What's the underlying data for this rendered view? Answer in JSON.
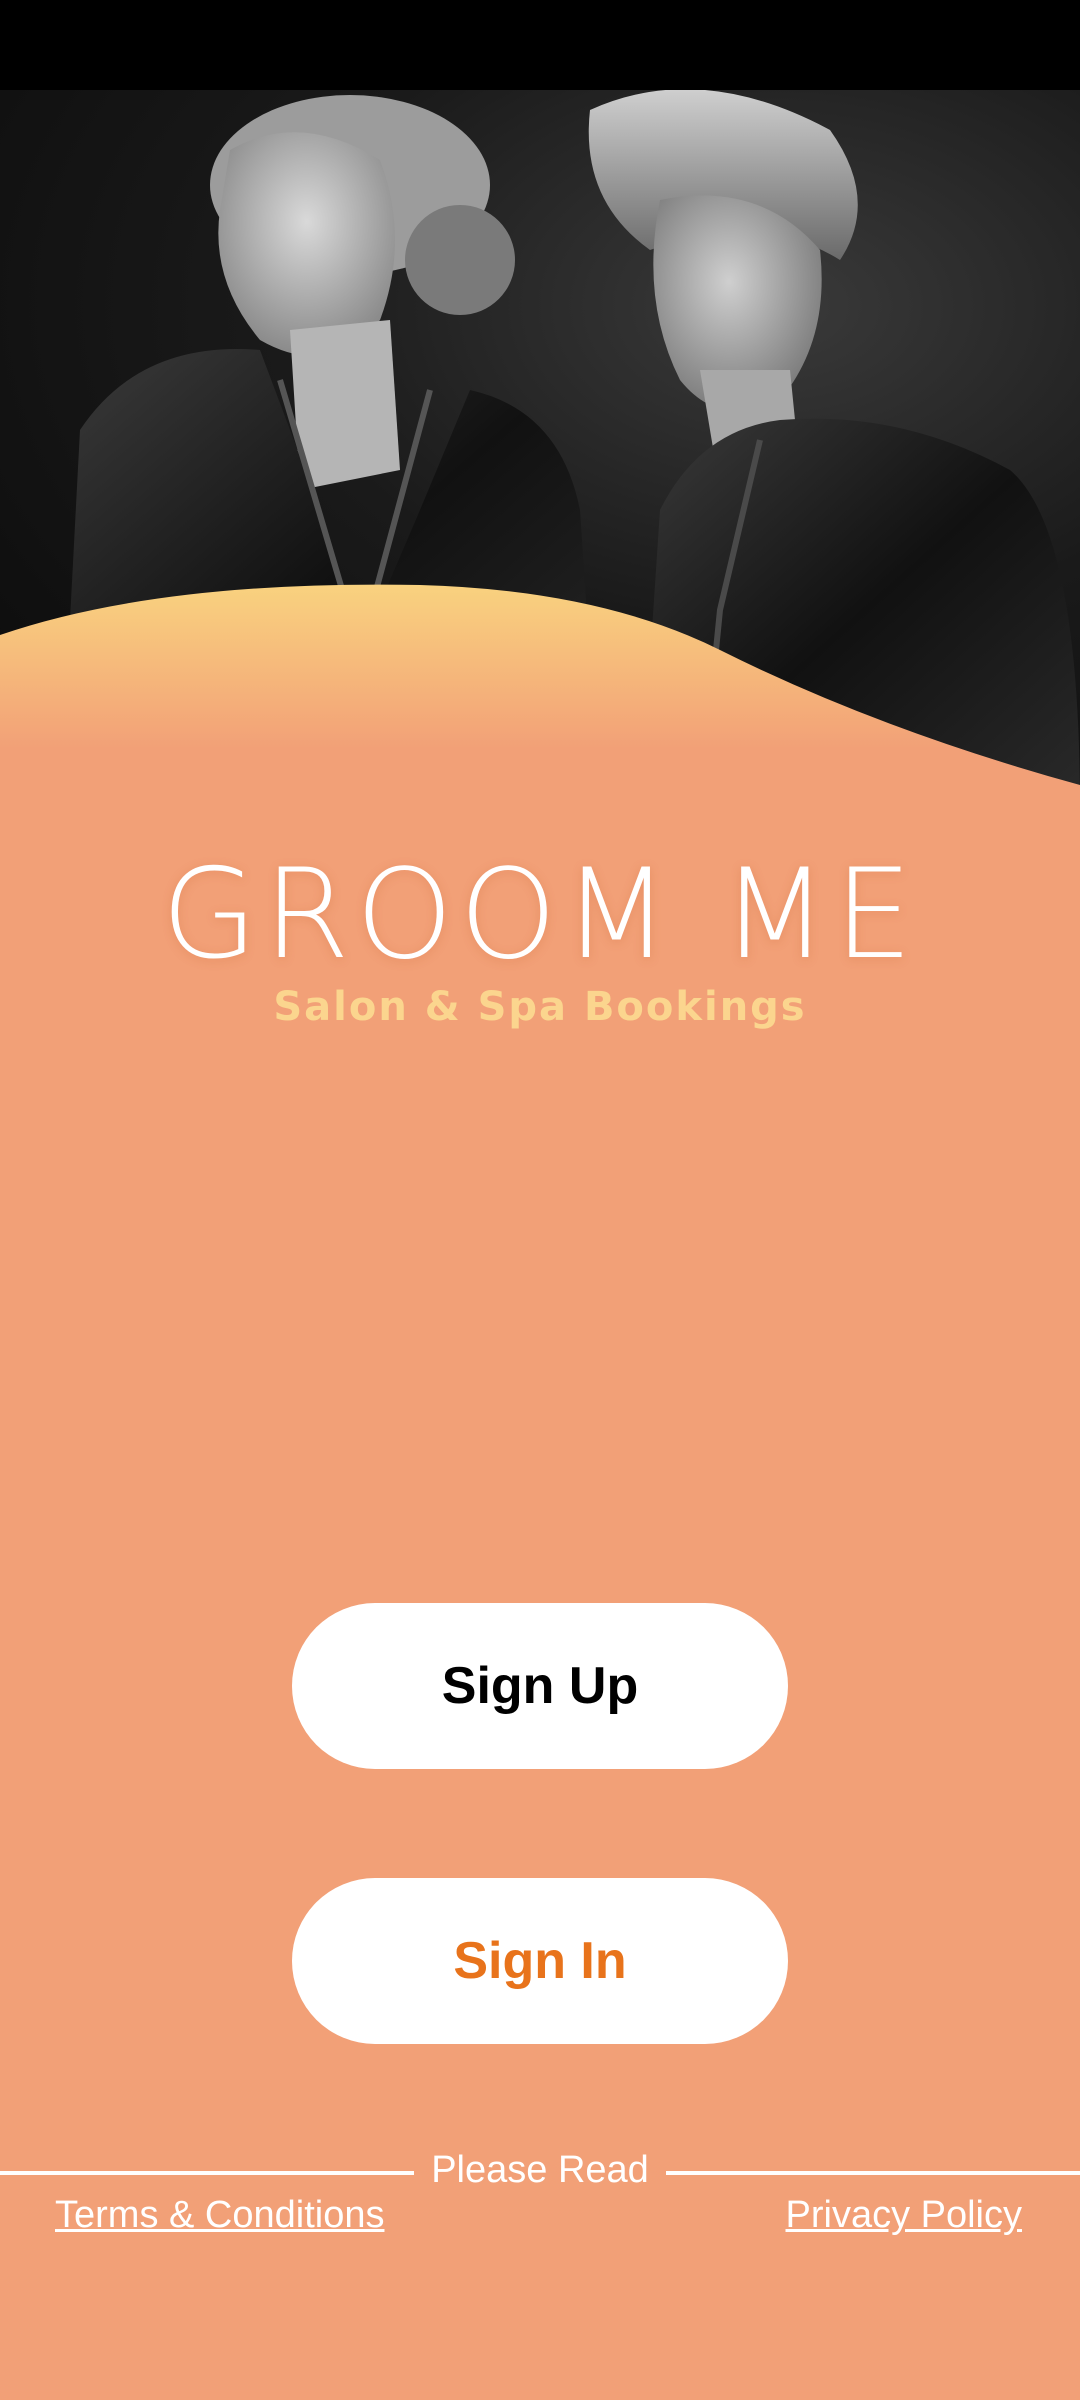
{
  "brand": {
    "title": "GROOM ME",
    "subtitle": "Salon & Spa Bookings"
  },
  "actions": {
    "sign_up_label": "Sign Up",
    "sign_in_label": "Sign In"
  },
  "footer": {
    "divider_label": "Please Read",
    "terms_label": "Terms & Conditions",
    "privacy_label": "Privacy Policy"
  },
  "colors": {
    "background": "#f2a077",
    "wave_top": "#f9d27f",
    "brand_subtitle": "#fbd58e",
    "sign_in_text": "#e8731b",
    "status_bar": "#000000"
  },
  "hero": {
    "image_icon": "models-photo-icon"
  }
}
